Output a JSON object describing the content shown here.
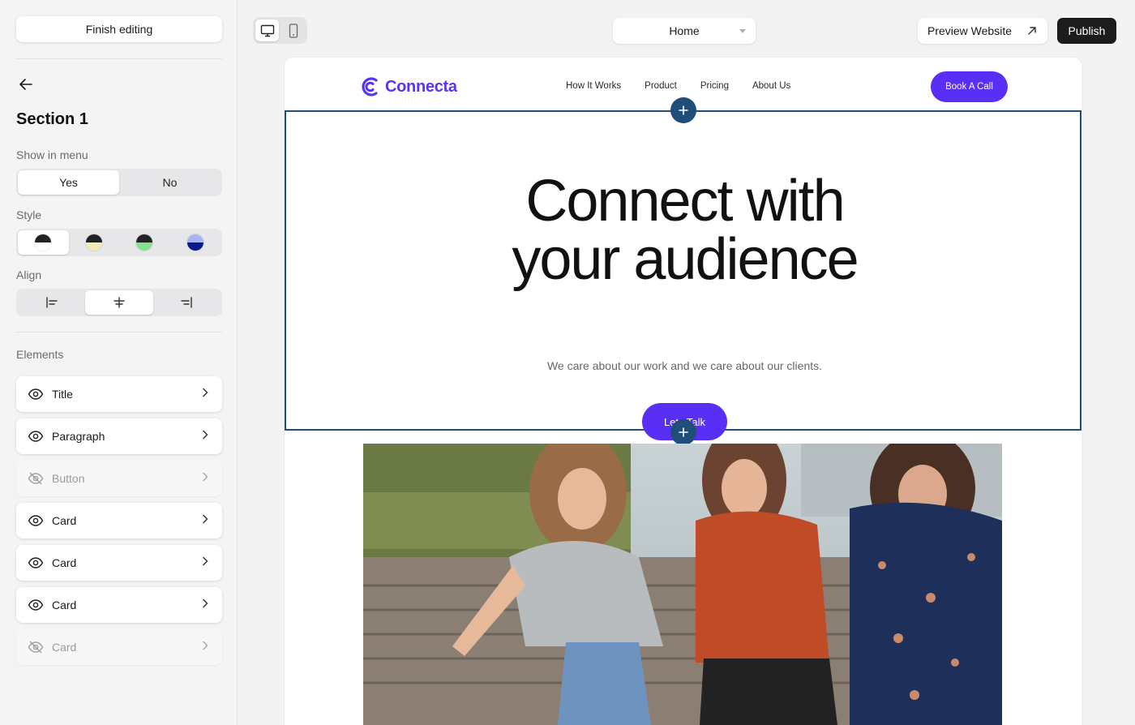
{
  "sidebar": {
    "finish_label": "Finish editing",
    "section_title": "Section 1",
    "show_in_menu": {
      "label": "Show in menu",
      "yes": "Yes",
      "no": "No",
      "selected": "Yes"
    },
    "style": {
      "label": "Style",
      "swatches": [
        {
          "top": "#222222",
          "bottom": "#ffffff"
        },
        {
          "top": "#222222",
          "bottom": "#f5e9b8"
        },
        {
          "top": "#222222",
          "bottom": "#86e08f"
        },
        {
          "top": "#a8b3f5",
          "bottom": "#0b1a8a"
        }
      ]
    },
    "align": {
      "label": "Align",
      "selected": "center"
    },
    "elements_label": "Elements",
    "elements": [
      {
        "label": "Title",
        "visible": true
      },
      {
        "label": "Paragraph",
        "visible": true
      },
      {
        "label": "Button",
        "visible": false
      },
      {
        "label": "Card",
        "visible": true
      },
      {
        "label": "Card",
        "visible": true
      },
      {
        "label": "Card",
        "visible": true
      },
      {
        "label": "Card",
        "visible": false
      }
    ]
  },
  "toolbar": {
    "device_selected": "desktop",
    "page_select": "Home",
    "preview_label": "Preview Website",
    "publish_label": "Publish"
  },
  "site": {
    "logo_text": "Connecta",
    "nav": [
      "How It Works",
      "Product",
      "Pricing",
      "About Us"
    ],
    "cta": "Book A Call",
    "hero_title_line1": "Connect with",
    "hero_title_line2": "your audience",
    "hero_subtitle": "We care about our work and we care about our clients.",
    "hero_button": "Lets Talk"
  },
  "colors": {
    "brand_purple": "#5a2ff5",
    "selection_blue": "#1f4e79",
    "publish_dark": "#1c1c1e"
  }
}
